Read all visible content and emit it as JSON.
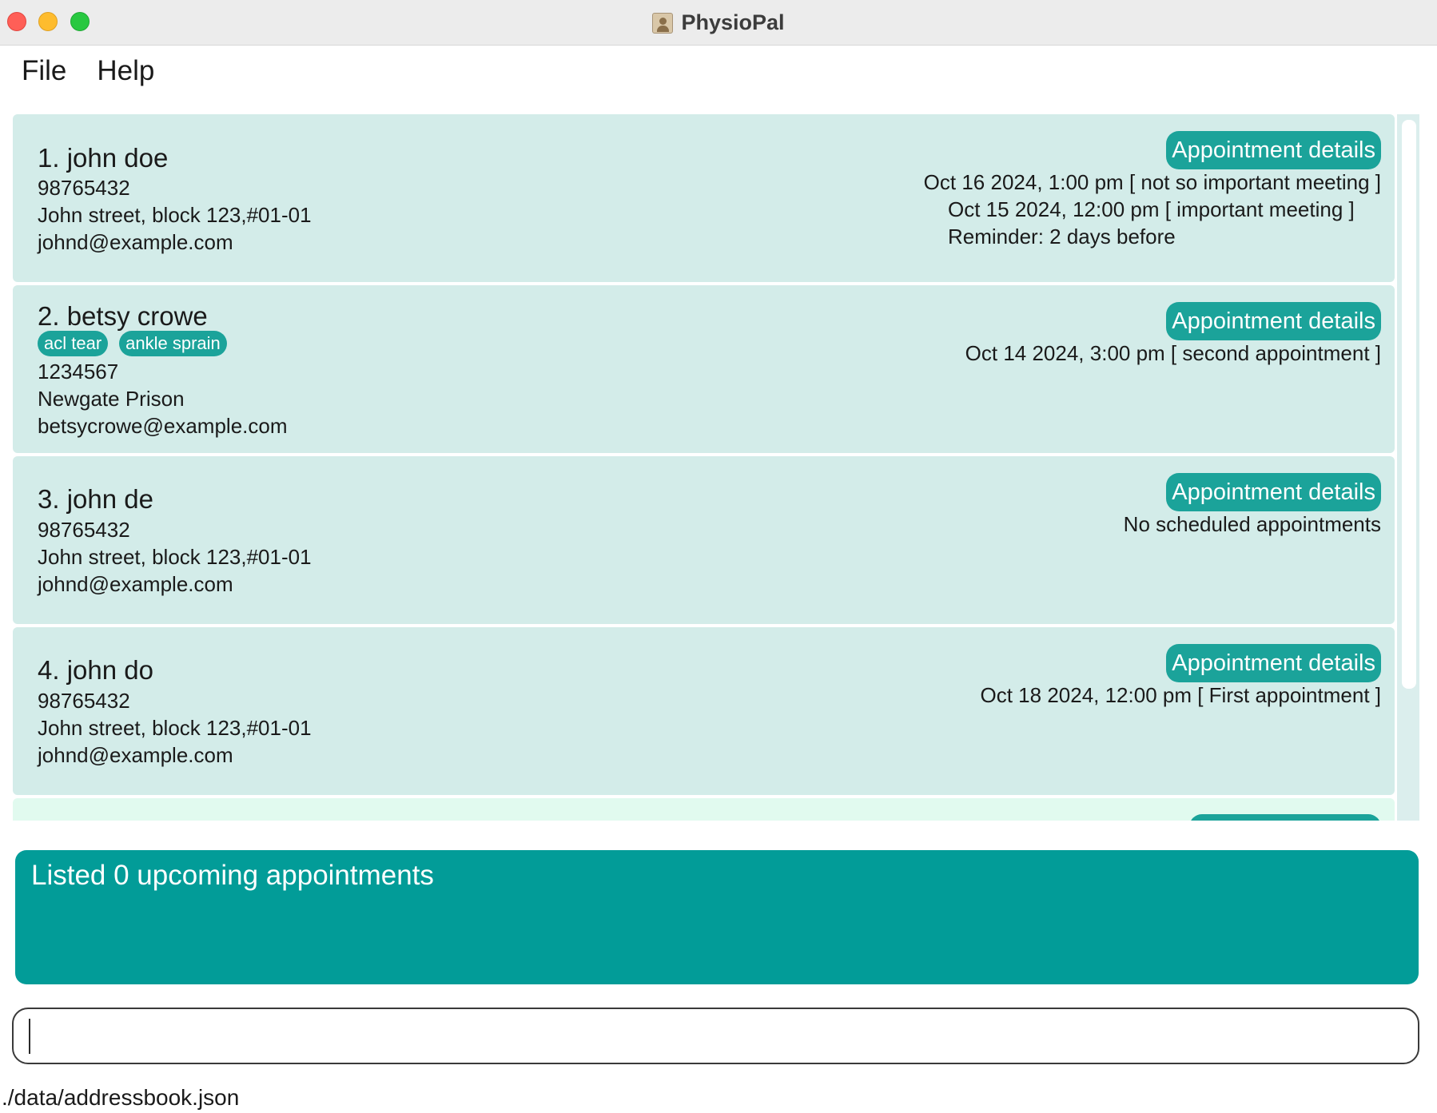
{
  "window": {
    "title": "PhysioPal"
  },
  "menu": {
    "items": [
      {
        "label": "File"
      },
      {
        "label": "Help"
      }
    ]
  },
  "patients": [
    {
      "name": "1. john doe",
      "tags": [],
      "phone": "98765432",
      "address": "John street, block 123,#01-01",
      "email": "johnd@example.com",
      "button": "Appointment details",
      "appointments": [
        "Oct 16 2024, 1:00 pm [ not so important meeting ]",
        "Oct 15 2024, 12:00 pm [ important meeting ]"
      ],
      "reminder": "Reminder: 2 days before"
    },
    {
      "name": "2. betsy crowe",
      "tags": [
        "acl tear",
        "ankle sprain"
      ],
      "phone": "1234567",
      "address": "Newgate Prison",
      "email": "betsycrowe@example.com",
      "button": "Appointment details",
      "appointments": [
        "Oct 14 2024, 3:00 pm [ second appointment ]"
      ]
    },
    {
      "name": "3. john de",
      "tags": [],
      "phone": "98765432",
      "address": "John street, block 123,#01-01",
      "email": "johnd@example.com",
      "button": "Appointment details",
      "appointments": [
        "No scheduled appointments"
      ]
    },
    {
      "name": "4. john do",
      "tags": [],
      "phone": "98765432",
      "address": "John street, block 123,#01-01",
      "email": "johnd@example.com",
      "button": "Appointment details",
      "appointments": [
        "Oct 18 2024, 12:00 pm [ First appointment ]"
      ]
    }
  ],
  "result": {
    "message": "Listed 0 upcoming appointments"
  },
  "command": {
    "value": ""
  },
  "status": {
    "file_path": "./data/addressbook.json"
  },
  "colors": {
    "card_bg": "#d3ece9",
    "accent": "#1ba39a",
    "result_bg": "#029c98"
  }
}
